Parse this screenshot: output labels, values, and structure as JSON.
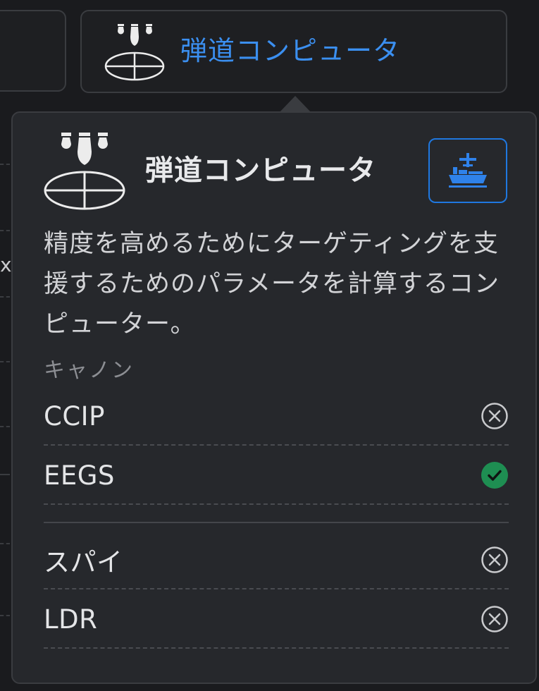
{
  "card": {
    "title": "弾道コンピュータ"
  },
  "popover": {
    "title": "弾道コンピュータ",
    "description": "精度を高めるためにターゲティングを支援するためのパラメータを計算するコンピューター。",
    "section_label": "キャノン",
    "vehicle_icon": "aircraft-carrier-icon",
    "groups": [
      {
        "items": [
          {
            "name": "CCIP",
            "status": "unavailable"
          },
          {
            "name": "EEGS",
            "status": "available"
          }
        ]
      },
      {
        "items": [
          {
            "name": "スパイ",
            "status": "unavailable"
          },
          {
            "name": "LDR",
            "status": "unavailable"
          }
        ]
      }
    ]
  },
  "background": {
    "partial_text": "x"
  },
  "colors": {
    "accent": "#3b8ff0",
    "available": "#1e8e52",
    "unavailable": "#c9cacd",
    "border": "#3a3c40"
  }
}
